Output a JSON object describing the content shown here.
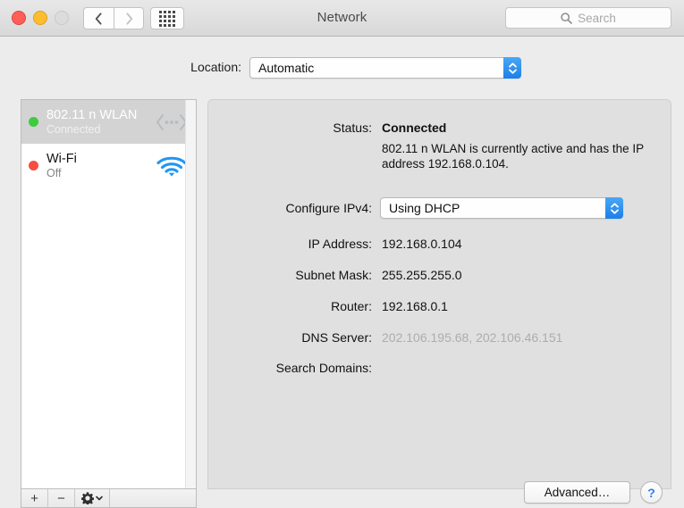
{
  "window": {
    "title": "Network",
    "traffic_lights": {
      "close_label": "close",
      "minimize_label": "minimize",
      "zoom_label": "zoom"
    },
    "nav": {
      "back_label": "Back",
      "forward_label": "Forward",
      "show_all_label": "Show All"
    },
    "search": {
      "placeholder": "Search",
      "value": ""
    }
  },
  "location": {
    "label": "Location:",
    "value": "Automatic",
    "options": [
      "Automatic"
    ]
  },
  "sidebar": {
    "items": [
      {
        "name": "802.11 n WLAN",
        "status": "Connected",
        "status_color": "#3ecb3e",
        "icon": "serial-adapter-icon",
        "selected": true
      },
      {
        "name": "Wi-Fi",
        "status": "Off",
        "status_color": "#f74c41",
        "icon": "wifi-icon",
        "selected": false
      }
    ],
    "toolbar": {
      "add_label": "+",
      "remove_label": "−",
      "actions_label": "Actions"
    }
  },
  "details": {
    "status": {
      "label": "Status:",
      "value": "Connected",
      "description": "802.11 n WLAN is currently active and has the IP address 192.168.0.104."
    },
    "configure_ipv4": {
      "label": "Configure IPv4:",
      "value": "Using DHCP",
      "options": [
        "Using DHCP"
      ]
    },
    "rows": [
      {
        "label": "IP Address:",
        "value": "192.168.0.104"
      },
      {
        "label": "Subnet Mask:",
        "value": "255.255.255.0"
      },
      {
        "label": "Router:",
        "value": "192.168.0.1"
      },
      {
        "label": "DNS Server:",
        "value": "202.106.195.68, 202.106.46.151"
      },
      {
        "label": "Search Domains:",
        "value": ""
      }
    ]
  },
  "footer": {
    "advanced_label": "Advanced…",
    "help_label": "?"
  },
  "colors": {
    "accent_blue": "#1c7fe8",
    "window_bg": "#ececec",
    "panel_bg": "#e0e0e0",
    "selected_row": "#d3d3d3",
    "dimmed_text": "#adadad"
  }
}
